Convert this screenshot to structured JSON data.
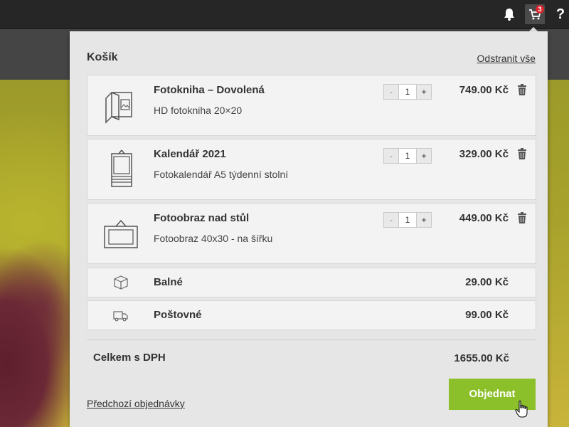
{
  "topbar": {
    "icons": [
      "bell-icon",
      "cart-icon",
      "help-icon"
    ],
    "cart_badge": "3",
    "help_label": "?"
  },
  "cart": {
    "title": "Košík",
    "clear_all": "Odstranit vše",
    "items": [
      {
        "name": "Fotokniha – Dovolená",
        "desc": "HD fotokniha 20×20",
        "qty": "1",
        "minus": "-",
        "plus": "+",
        "price": "749.00 Kč",
        "icon": "photobook-icon"
      },
      {
        "name": "Kalendář 2021",
        "desc": "Fotokalendář A5 týdenní stolní",
        "qty": "1",
        "minus": "-",
        "plus": "+",
        "price": "329.00 Kč",
        "icon": "calendar-icon"
      },
      {
        "name": "Fotoobraz nad stůl",
        "desc": "Fotoobraz 40x30 - na šířku",
        "qty": "1",
        "minus": "-",
        "plus": "+",
        "price": "449.00 Kč",
        "icon": "picture-frame-icon"
      }
    ],
    "fees": [
      {
        "name": "Balné",
        "price": "29.00 Kč",
        "icon": "package-icon"
      },
      {
        "name": "Poštovné",
        "price": "99.00 Kč",
        "icon": "truck-icon"
      }
    ],
    "total_label": "Celkem s DPH",
    "total_value": "1655.00 Kč",
    "previous_orders": "Předchozí objednávky",
    "order_button": "Objednat"
  },
  "colors": {
    "accent": "#8cc02a",
    "badge": "#d8262c",
    "panel": "#e6e6e6",
    "topbar": "#262626"
  }
}
